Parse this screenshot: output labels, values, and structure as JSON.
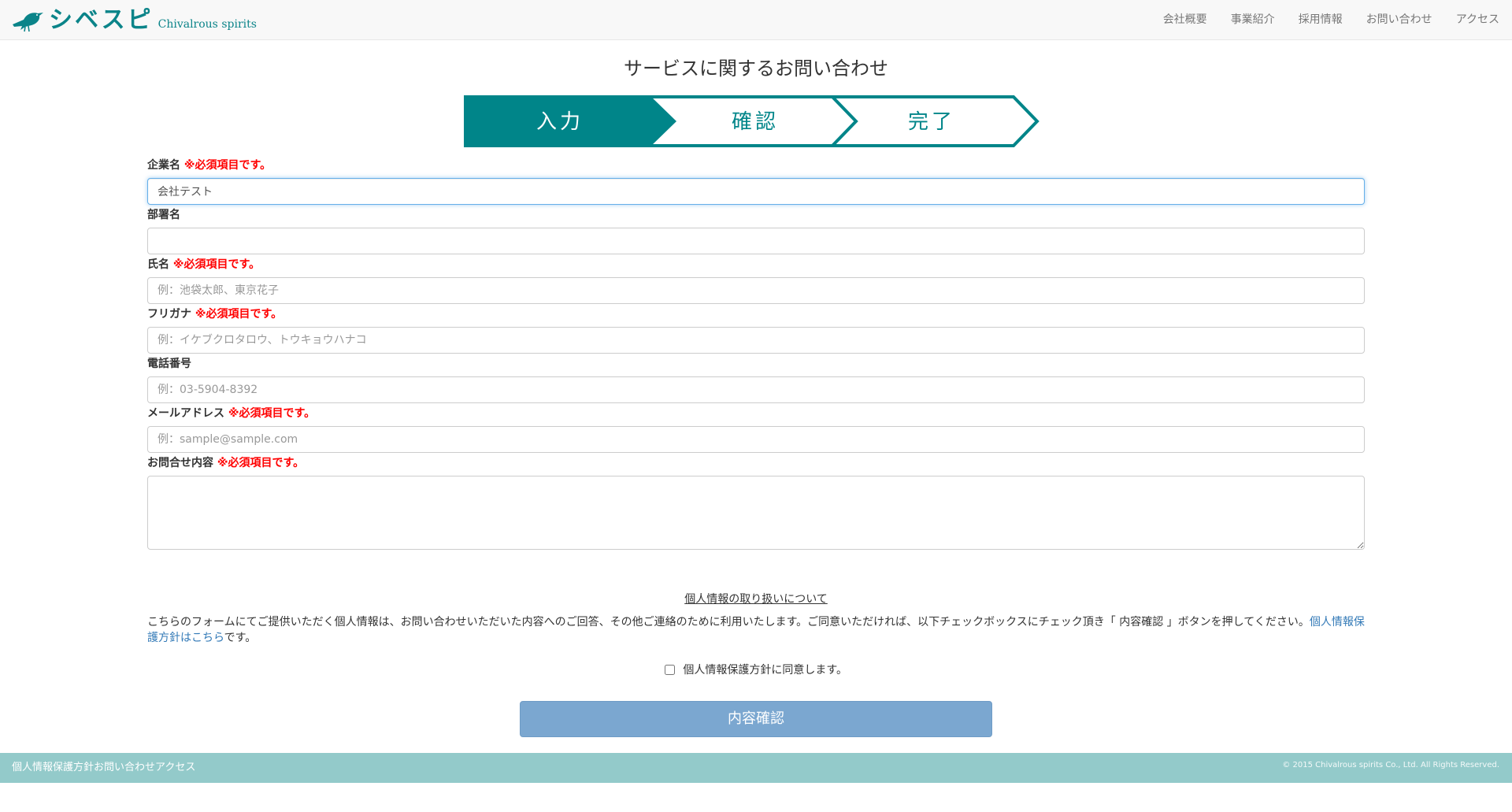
{
  "brand": {
    "name_jp": "シベスピ",
    "name_en": "Chivalrous spirits"
  },
  "nav": {
    "items": [
      {
        "label": "会社概要"
      },
      {
        "label": "事業紹介"
      },
      {
        "label": "採用情報"
      },
      {
        "label": "お問い合わせ"
      },
      {
        "label": "アクセス"
      }
    ]
  },
  "page_title": "サービスに関するお問い合わせ",
  "steps": {
    "items": [
      {
        "label": "入力",
        "state": "active"
      },
      {
        "label": "確認",
        "state": "inactive"
      },
      {
        "label": "完了",
        "state": "inactive"
      }
    ],
    "colors": {
      "active_bg": "#008589",
      "active_text": "#ffffff",
      "inactive_bg": "#ffffff",
      "inactive_text": "#008589",
      "border": "#008589"
    }
  },
  "required_note": "※必須項目です。",
  "form": {
    "company": {
      "label": "企業名",
      "value": "会社テスト",
      "placeholder": ""
    },
    "department": {
      "label": "部署名",
      "value": "",
      "placeholder": ""
    },
    "name": {
      "label": "氏名",
      "value": "",
      "placeholder": "例：池袋太郎、東京花子"
    },
    "furigana": {
      "label": "フリガナ",
      "value": "",
      "placeholder": "例：イケブクロタロウ、トウキョウハナコ"
    },
    "phone": {
      "label": "電話番号",
      "value": "",
      "placeholder": "例：03-5904-8392"
    },
    "email": {
      "label": "メールアドレス",
      "value": "",
      "placeholder": "例：sample@sample.com"
    },
    "inquiry": {
      "label": "お問合せ内容",
      "value": "",
      "placeholder": ""
    }
  },
  "privacy": {
    "title": "個人情報の取り扱いについて",
    "text": "こちらのフォームにてご提供いただく個人情報は、お問い合わせいただいた内容へのご回答、その他ご連絡のために利用いたします。ご同意いただければ、以下チェックボックスにチェック頂き「 内容確認 」ボタンを押してください。",
    "link_text": "個人情報保護方針はこちら",
    "suffix": "です。",
    "agree_label": "個人情報保護方針に同意します。"
  },
  "submit_label": "内容確認",
  "footer": {
    "links": [
      {
        "label": "個人情報保護方針"
      },
      {
        "label": "お問い合わせ"
      },
      {
        "label": "アクセス"
      }
    ],
    "copyright": "© 2015 Chivalrous spirits Co., Ltd. All Rights Reserved."
  }
}
